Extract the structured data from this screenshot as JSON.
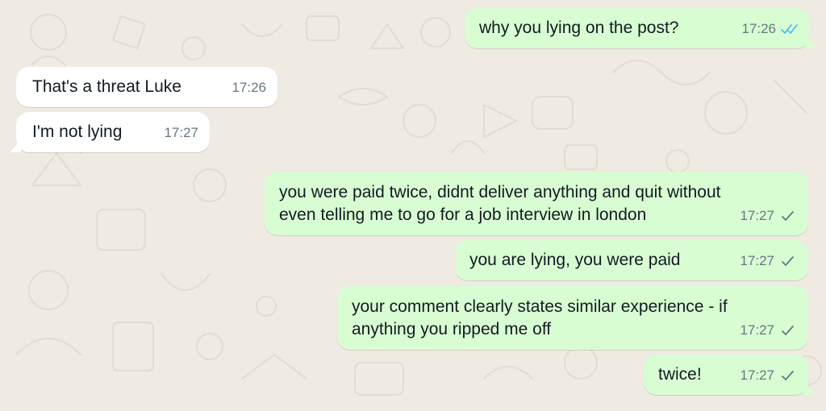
{
  "colors": {
    "wallpaper": "#efeae2",
    "outgoing_bubble": "#d9fdd3",
    "incoming_bubble": "#ffffff",
    "read_receipt": "#53bdeb",
    "delivered_receipt": "#667781"
  },
  "messages": [
    {
      "direction": "outgoing",
      "lines": [
        "why you lying on the post?"
      ],
      "time": "17:26",
      "status": "read",
      "status_icon": "double-check-icon"
    },
    {
      "direction": "incoming",
      "lines": [
        "That's a threat Luke"
      ],
      "time": "17:26"
    },
    {
      "direction": "incoming",
      "lines": [
        "I'm not lying"
      ],
      "time": "17:27"
    },
    {
      "direction": "outgoing",
      "lines": [
        "you were paid twice, didnt deliver anything and quit without",
        "even telling me to go for a job interview in london"
      ],
      "time": "17:27",
      "status": "sent",
      "status_icon": "single-check-icon"
    },
    {
      "direction": "outgoing",
      "lines": [
        "you are lying, you were paid"
      ],
      "time": "17:27",
      "status": "sent",
      "status_icon": "single-check-icon"
    },
    {
      "direction": "outgoing",
      "lines": [
        "your comment clearly states similar experience - if",
        "anything you ripped me off"
      ],
      "time": "17:27",
      "status": "sent",
      "status_icon": "single-check-icon"
    },
    {
      "direction": "outgoing",
      "lines": [
        "twice!"
      ],
      "time": "17:27",
      "status": "sent",
      "status_icon": "single-check-icon"
    }
  ]
}
